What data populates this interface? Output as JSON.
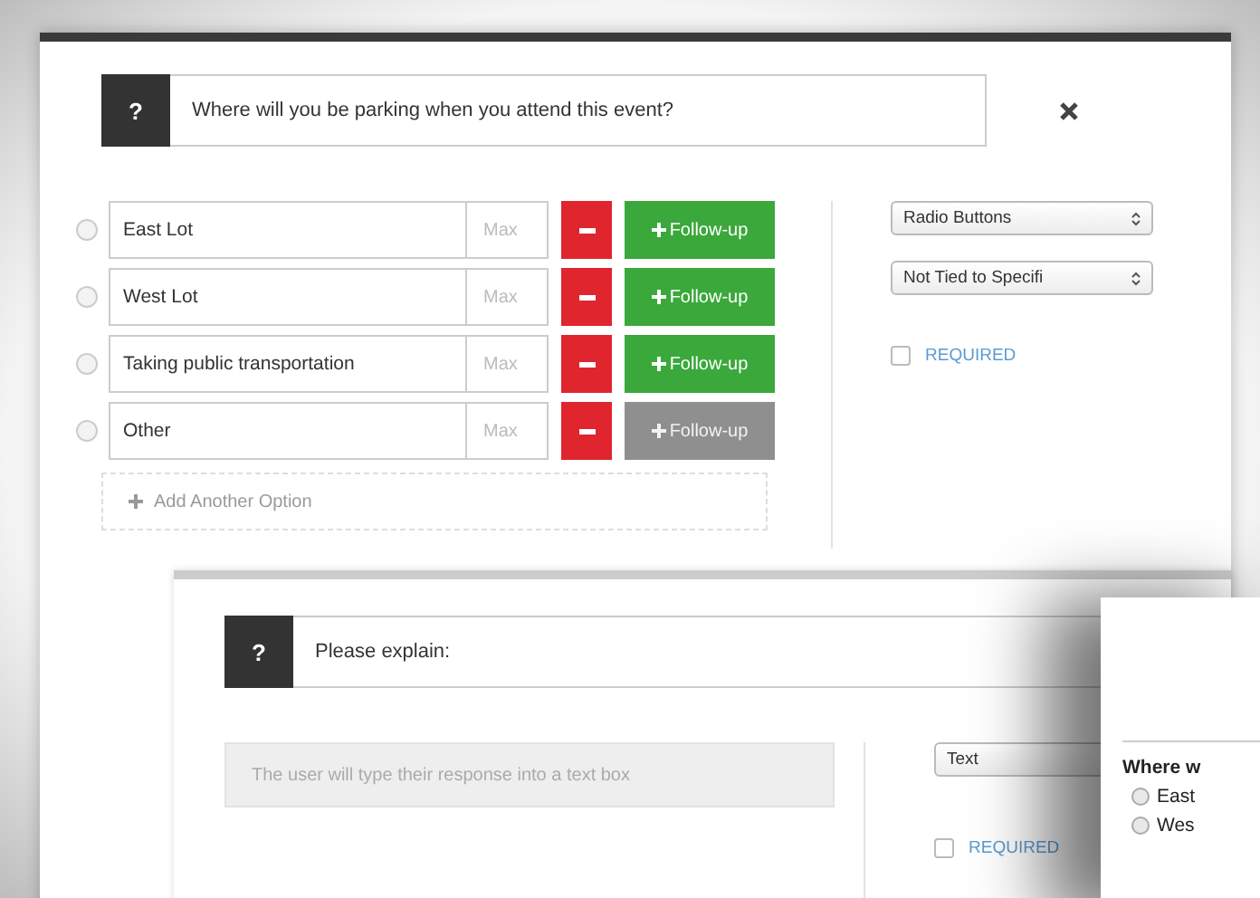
{
  "question": {
    "badge": "?",
    "text": "Where will you be parking when you attend this event?"
  },
  "options": [
    {
      "label": "East Lot",
      "max_placeholder": "Max",
      "follow_up": "Follow-up",
      "follow_up_enabled": true
    },
    {
      "label": "West Lot",
      "max_placeholder": "Max",
      "follow_up": "Follow-up",
      "follow_up_enabled": true
    },
    {
      "label": "Taking public transportation",
      "max_placeholder": "Max",
      "follow_up": "Follow-up",
      "follow_up_enabled": true
    },
    {
      "label": "Other",
      "max_placeholder": "Max",
      "follow_up": "Follow-up",
      "follow_up_enabled": false
    }
  ],
  "add_option": "Add Another Option",
  "settings": {
    "answer_type": "Radio Buttons",
    "tie": "Not Tied to Specifi",
    "required": {
      "label": "REQUIRED",
      "checked": false
    }
  },
  "follow_up_question": {
    "badge": "?",
    "text": "Please explain:",
    "answer_placeholder": "The user will type their response into a text box",
    "answer_type": "Text",
    "required": {
      "label": "REQUIRED",
      "checked": false
    }
  },
  "preview": {
    "question": "Where w",
    "options": [
      {
        "label": "East",
        "selected": false
      },
      {
        "label": "Wes",
        "selected": false
      }
    ]
  }
}
